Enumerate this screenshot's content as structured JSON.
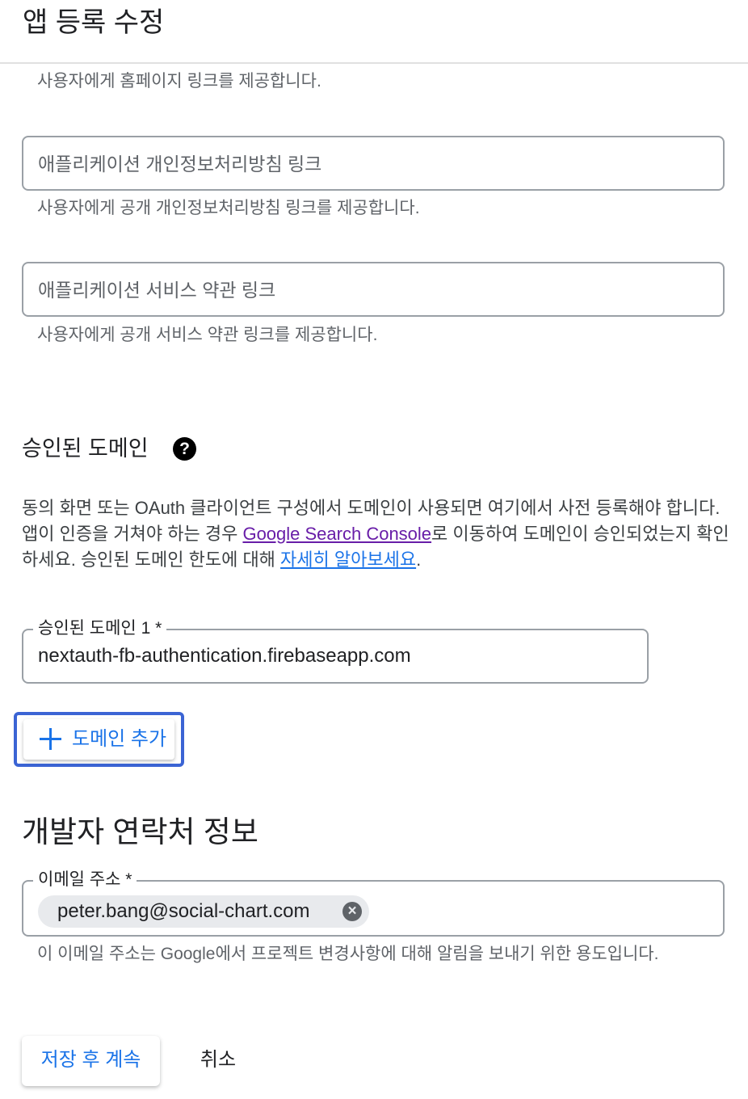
{
  "header": {
    "title": "앱 등록 수정"
  },
  "homepage": {
    "helper": "사용자에게 홈페이지 링크를 제공합니다."
  },
  "privacy_policy": {
    "placeholder": "애플리케이션 개인정보처리방침 링크",
    "helper": "사용자에게 공개 개인정보처리방침 링크를 제공합니다."
  },
  "terms_of_service": {
    "placeholder": "애플리케이션 서비스 약관 링크",
    "helper": "사용자에게 공개 서비스 약관 링크를 제공합니다."
  },
  "authorized_domains": {
    "heading": "승인된 도메인",
    "help_icon": "help-circle-icon",
    "description_part1": "동의 화면 또는 OAuth 클라이언트 구성에서 도메인이 사용되면 여기에서 사전 등록해야 합니다. 앱이 인증을 거쳐야 하는 경우 ",
    "description_link1": "Google Search Console",
    "description_part2": "로 이동하여 도메인이 승인되었는지 확인하세요. 승인된 도메인 한도에 대해 ",
    "description_link2": "자세히 알아보세요",
    "description_part3": ".",
    "domain1_label": "승인된 도메인 1 *",
    "domain1_value": "nextauth-fb-authentication.firebaseapp.com",
    "add_button_label": "도메인 추가",
    "add_button_icon": "plus-icon"
  },
  "developer_contact": {
    "heading": "개발자 연락처 정보",
    "email_label": "이메일 주소 *",
    "email_chip": "peter.bang@social-chart.com",
    "chip_icon": "close-circle-icon",
    "helper": "이 이메일 주소는 Google에서 프로젝트 변경사항에 대해 알림을 보내기 위한 용도입니다."
  },
  "actions": {
    "save_label": "저장 후 계속",
    "cancel_label": "취소"
  },
  "colors": {
    "accent": "#1a73e8",
    "focus_ring": "#3b64d4",
    "visited_link": "#681da8"
  }
}
